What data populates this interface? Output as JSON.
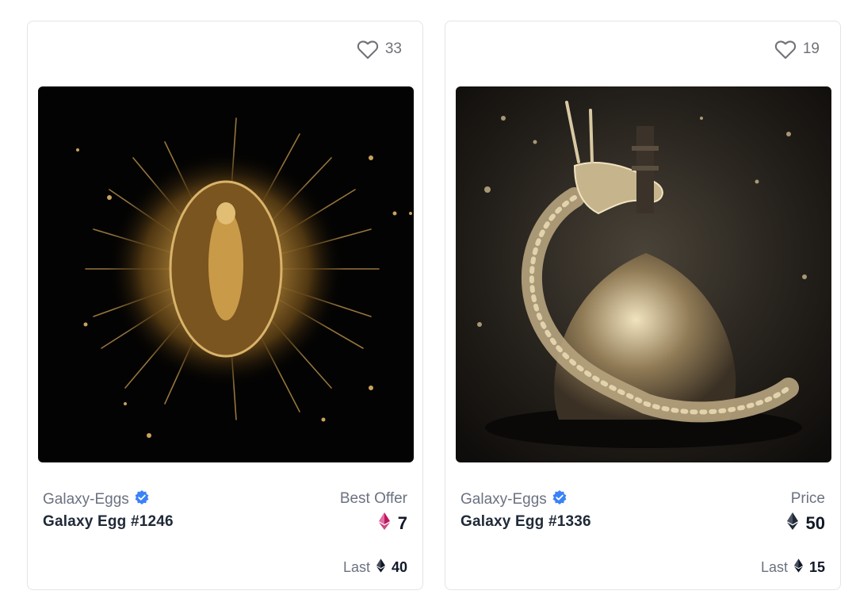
{
  "cards": [
    {
      "favorites": "33",
      "collection": "Galaxy-Eggs",
      "name": "Galaxy Egg #1246",
      "price_label": "Best Offer",
      "price": "7",
      "price_currency_color": "#be185d",
      "last_label": "Last",
      "last_price": "40"
    },
    {
      "favorites": "19",
      "collection": "Galaxy-Eggs",
      "name": "Galaxy Egg #1336",
      "price_label": "Price",
      "price": "50",
      "price_currency_color": "#1f2937",
      "last_label": "Last",
      "last_price": "15"
    }
  ],
  "icons": {
    "favorite": "heart-outline-icon",
    "verified": "verified-badge-icon",
    "currency": "ethereum-icon"
  },
  "colors": {
    "verified": "#3b82f6",
    "offer_eth": "#be185d"
  }
}
